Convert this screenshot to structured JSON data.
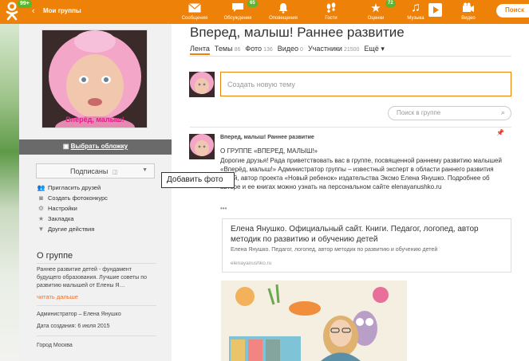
{
  "topbar": {
    "logo_badge": "99+",
    "back_label": "‹",
    "my_groups": "Мои группы",
    "search_label": "Поиск",
    "nav": [
      {
        "name": "messages",
        "label": "Сообщения",
        "icon": "envelope-icon",
        "badge": ""
      },
      {
        "name": "discussions",
        "label": "Обсуждения",
        "icon": "chat-icon",
        "badge": "65"
      },
      {
        "name": "notifications",
        "label": "Оповещения",
        "icon": "bell-icon",
        "badge": ""
      },
      {
        "name": "guests",
        "label": "Гости",
        "icon": "footprints-icon",
        "badge": ""
      },
      {
        "name": "ratings",
        "label": "Оценки",
        "icon": "star-icon",
        "badge": "72"
      },
      {
        "name": "music",
        "label": "Музыка",
        "icon": "music-note-icon",
        "badge": ""
      },
      {
        "name": "video",
        "label": "Видео",
        "icon": "film-icon",
        "badge": ""
      }
    ]
  },
  "left": {
    "avatar_text": "Вперёд, малыш!",
    "cover_label": "Выбрать обложку",
    "subscribed_label": "Подписаны",
    "actions": [
      {
        "label": "Пригласить друзей",
        "icon": "people-icon"
      },
      {
        "label": "Создать фотоконкурс",
        "icon": "camera-icon"
      },
      {
        "label": "Настройки",
        "icon": "gear-icon"
      },
      {
        "label": "Закладка",
        "icon": "bookmark-icon"
      },
      {
        "label": "Другие действия",
        "icon": "triangle-down-icon"
      }
    ],
    "about_title": "О группе",
    "about_text": "Раннее развитие детей - фундамент будущего образования. Лучшие советы по развитию малышей от Елены Я…",
    "read_more": "читать дальше",
    "admin": "Администратор – Елена Янушко",
    "created": "Дата создания: 6 июля 2015",
    "city": "Город Москва"
  },
  "tooltip": "Добавить фото",
  "main": {
    "title": "Вперед, малыш! Раннее развитие",
    "tabs": [
      {
        "label": "Лента",
        "count": ""
      },
      {
        "label": "Темы",
        "count": "86"
      },
      {
        "label": "Фото",
        "count": "136"
      },
      {
        "label": "Видео",
        "count": "0"
      },
      {
        "label": "Участники",
        "count": "21500"
      },
      {
        "label": "Ещё ▾",
        "count": ""
      }
    ],
    "new_topic_placeholder": "Создать новую тему",
    "group_search_placeholder": "Поиск в группе",
    "post": {
      "author": "Вперед, малыш! Раннее развитие",
      "heading": "О ГРУППЕ «ВПЕРЕД, МАЛЫШ!»",
      "body": "Дорогие друзья! Рада приветствовать вас в группе, посвященной раннему развитию малышей «Вперёд, малыш!» Администратор группы – известный эксперт в области раннего развития детей, автор проекта «Новый ребенок» издательства Эксмо Елена Янушко. Подробнее об авторе и ее книгах можно узнать на персональном сайте elenayanushko.ru",
      "dots": "•••",
      "link_title": "Елена Янушко. Официальный сайт. Книги. Педагог, логопед, автор методик по развитию и обучению детей",
      "link_desc": "Елена Янушко. Педагог, логопед, автор методик по развитию и обучению детей",
      "link_url": "elenayanushko.ru"
    }
  },
  "colors": {
    "accent": "#ee8208",
    "badge": "#5db52e",
    "link": "#eb722e"
  }
}
